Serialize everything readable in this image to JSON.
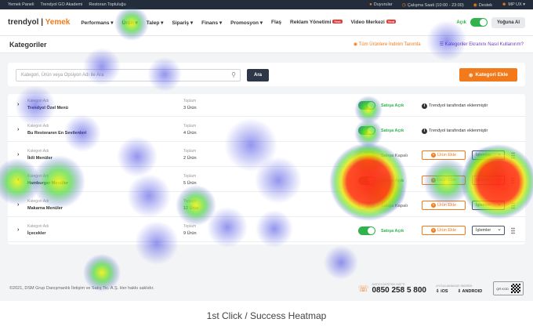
{
  "topbar": {
    "left": [
      "Yemek Paneli",
      "Trendyol GO Akademi",
      "Restoran Topluluğu"
    ],
    "duyurular": "Duyurular",
    "hours": "Çalışma Saati (10:00 - 23:00)",
    "destek": "Destek",
    "user": "MP UX"
  },
  "nav": {
    "logo_a": "trendyol",
    "logo_sep": " | ",
    "logo_b": "Yemek",
    "items": [
      "Performans",
      "Ürün",
      "Talep",
      "Sipariş",
      "Finans",
      "Promosyon",
      "Flaş",
      "Reklam Yönetimi",
      "Video Merkezi"
    ],
    "new_badge": "Yeni",
    "open_label": "Açık",
    "busy_label": "Yoğuna Al"
  },
  "subhead": {
    "title": "Kategoriler",
    "link1": "Tüm Ürünlere İndirim Tanımla",
    "link2": "Kategoriler Ekranını Nasıl Kullanırım?"
  },
  "search": {
    "placeholder": "Kategori, Ürün veya Opsiyon Adı ile Ara",
    "button": "Ara",
    "add_button": "Kategori Ekle"
  },
  "table": {
    "name_label": "Kategori Adı",
    "total_label": "Toplam",
    "info_text": "Trendyol tarafından eklenmiştir",
    "add_product": "Ürün Ekle",
    "actions": "İşlemler",
    "rows": [
      {
        "name": "Trendyol Özel Menü",
        "count": "3 Ürün",
        "status": "Satışa Açık",
        "on": true,
        "system": true
      },
      {
        "name": "Bu Restoranın En Sevilenleri",
        "count": "4 Ürün",
        "status": "Satışa Açık",
        "on": true,
        "system": true
      },
      {
        "name": "İkili Menüler",
        "count": "2 Ürün",
        "status": "Satışa Kapalı",
        "on": false,
        "system": false
      },
      {
        "name": "Hamburger Menüler",
        "count": "5 Ürün",
        "status": "Satışa Açık",
        "on": true,
        "system": false
      },
      {
        "name": "Makarna Menüler",
        "count": "12 Ürün",
        "status": "Satışa Kapalı",
        "on": false,
        "system": false
      },
      {
        "name": "İçecekler",
        "count": "9 Ürün",
        "status": "Satışa Açık",
        "on": true,
        "system": false
      }
    ]
  },
  "footer": {
    "copyright": "©2021, DSM Grup Danışmanlık İletişim ve Satış Tic. A.Ş. Her hakkı saklıdır.",
    "support_label": "SATICI DESTEK HATTI",
    "phone": "0850 258 5 800",
    "apps_label": "UYGULAMAMIZI İNDİRİN",
    "ios": "iOS",
    "android": "ANDROID",
    "qr": "QR KOD"
  },
  "caption": "1st Click / Success Heatmap",
  "colors": {
    "accent": "#f27a1a",
    "on": "#2fb34a",
    "dark": "#232c3b"
  }
}
